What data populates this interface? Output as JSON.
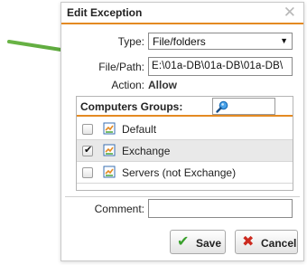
{
  "dialog": {
    "title": "Edit Exception",
    "close_icon": "close-icon"
  },
  "form": {
    "type_label": "Type:",
    "type_value": "File/folders",
    "filepath_label": "File/Path:",
    "filepath_value": "E:\\01a-DB\\01a-DB\\01a-DB\\",
    "action_label": "Action:",
    "action_value": "Allow",
    "comment_label": "Comment:",
    "comment_value": ""
  },
  "groups": {
    "title": "Computers Groups:",
    "search_placeholder": "",
    "items": [
      {
        "label": "Default",
        "checked": false
      },
      {
        "label": "Exchange",
        "checked": true
      },
      {
        "label": "Servers (not Exchange)",
        "checked": false
      }
    ]
  },
  "buttons": {
    "save_label": "Save",
    "cancel_label": "Cancel"
  },
  "colors": {
    "accent": "#e48a22",
    "arrow": "#5aa63a",
    "save_icon": "#3aa02c",
    "cancel_icon": "#cc2a1f"
  }
}
